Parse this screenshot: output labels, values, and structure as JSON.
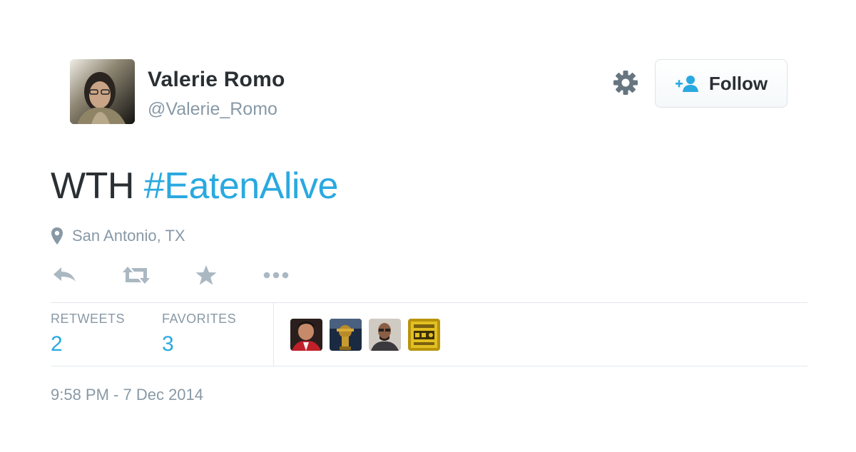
{
  "header": {
    "fullname": "Valerie Romo",
    "screenname": "@Valerie_Romo",
    "follow_label": "Follow"
  },
  "tweet": {
    "text": "WTH",
    "hashtag": "#EatenAlive",
    "location": "San Antonio, TX",
    "timestamp": "9:58 PM - 7 Dec 2014"
  },
  "actions": {
    "icons": [
      "reply-icon",
      "retweet-icon",
      "favorite-icon",
      "more-icon"
    ]
  },
  "stats": {
    "retweets_label": "RETWEETS",
    "retweets_count": "2",
    "favorites_label": "FAVORITES",
    "favorites_count": "3"
  },
  "colors": {
    "text": "#292f33",
    "muted": "#8899a6",
    "link": "#2aa9e0",
    "border": "#e1e8ed"
  }
}
